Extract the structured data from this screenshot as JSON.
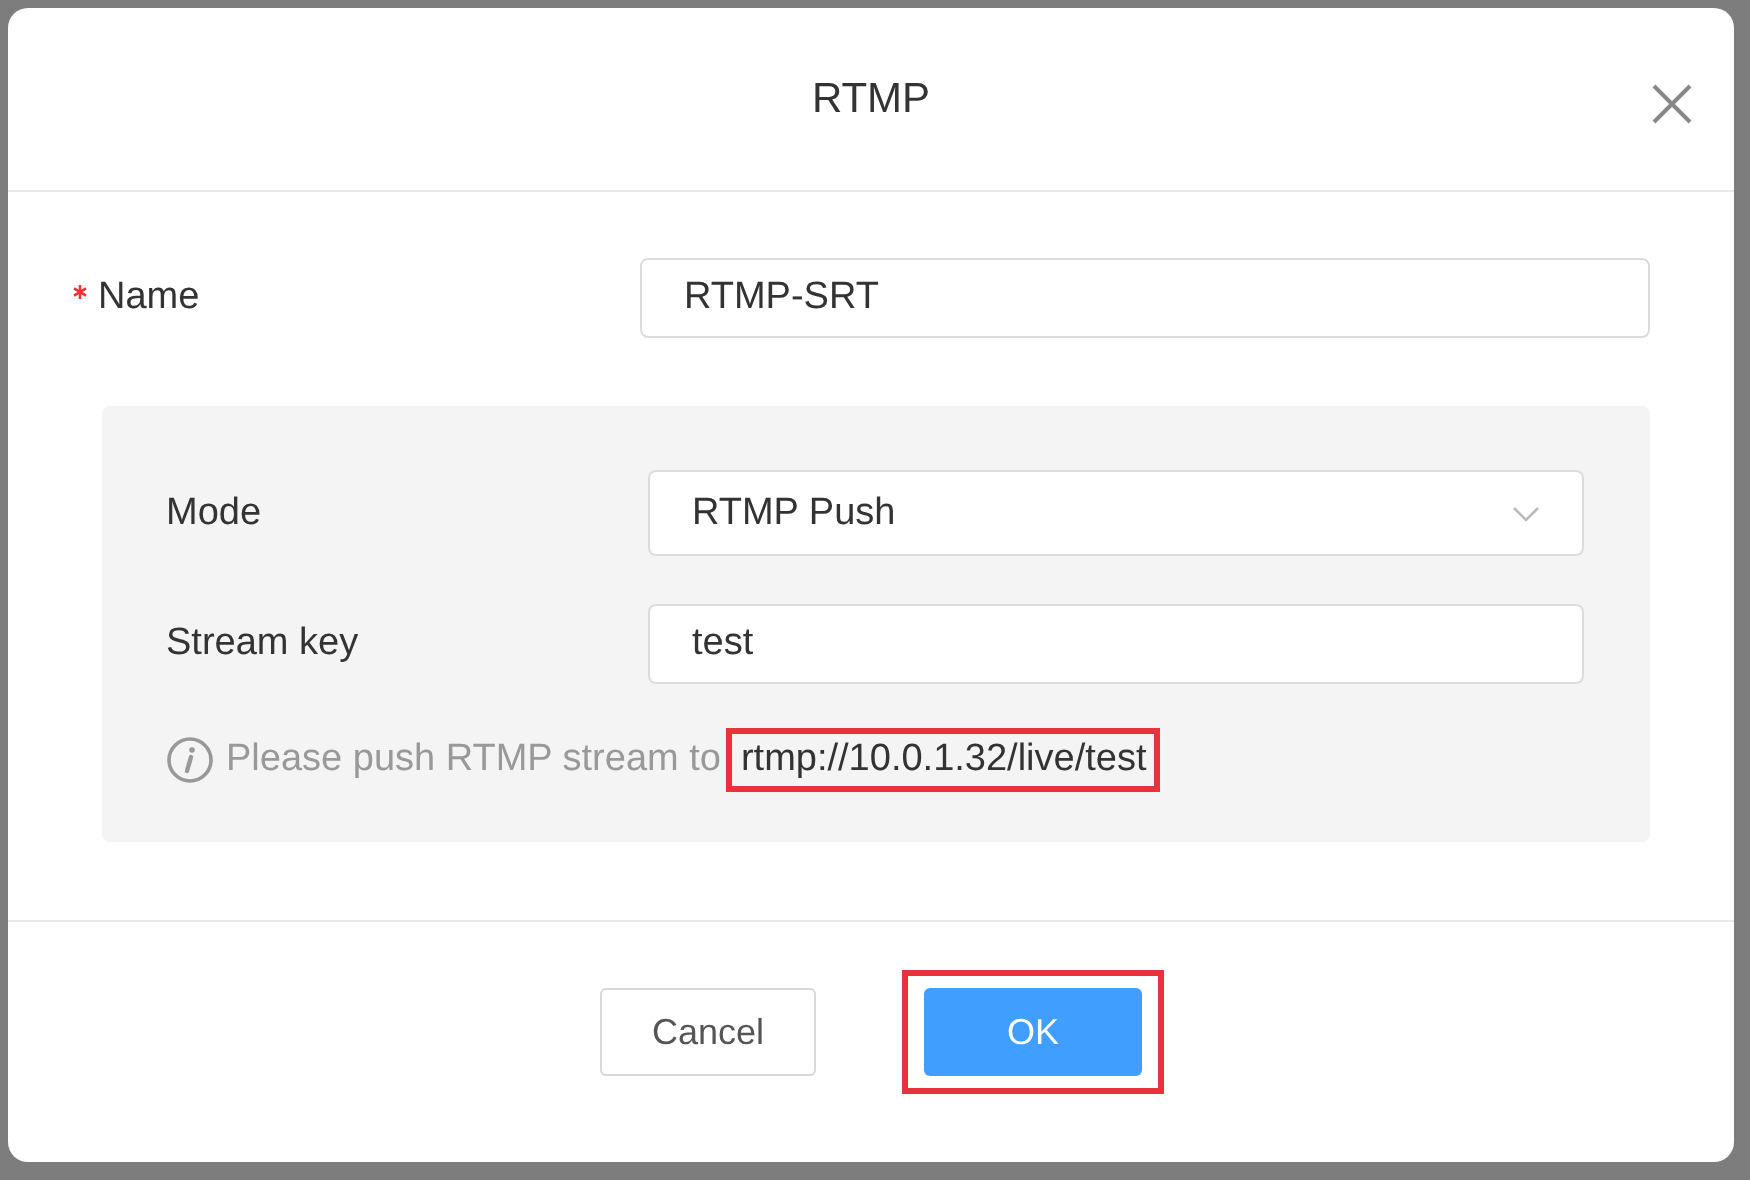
{
  "dialog": {
    "title": "RTMP"
  },
  "name_field": {
    "label": "Name",
    "required": true,
    "value": "RTMP-SRT"
  },
  "panel": {
    "mode": {
      "label": "Mode",
      "value": "RTMP Push"
    },
    "stream_key": {
      "label": "Stream key",
      "value": "test"
    },
    "info": {
      "text": "Please push RTMP stream to",
      "url": "rtmp://10.0.1.32/live/test",
      "url_highlighted": true
    }
  },
  "buttons": [
    {
      "label": "Cancel",
      "kind": "secondary",
      "highlighted": false
    },
    {
      "label": "OK",
      "kind": "primary",
      "highlighted": true
    }
  ]
}
